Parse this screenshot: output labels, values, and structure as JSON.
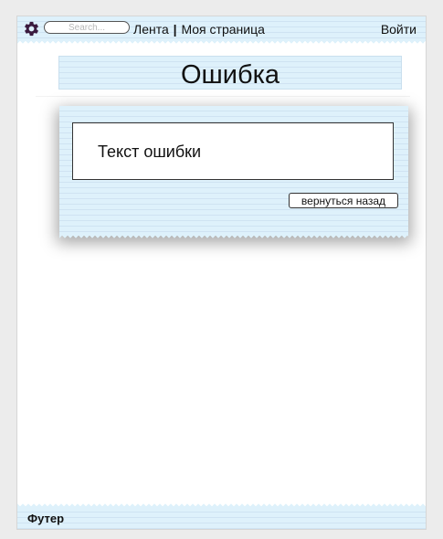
{
  "header": {
    "search_placeholder": "Search...",
    "nav": {
      "feed": "Лента",
      "separator": "|",
      "my_page": "Моя страница"
    },
    "login": "Войти",
    "settings_icon": "gear-icon"
  },
  "main": {
    "title": "Ошибка",
    "error_message": "Текст ошибки",
    "back_button": "вернуться назад"
  },
  "footer": {
    "text": "Футер"
  },
  "colors": {
    "paper": "#def1fb",
    "paper_lines": "#cfe3f2",
    "gear": "#3b1b3f",
    "page_background": "#ececec"
  }
}
